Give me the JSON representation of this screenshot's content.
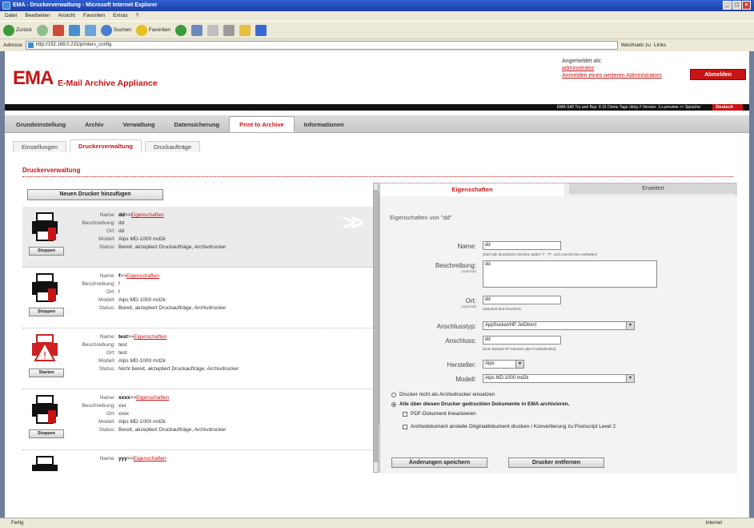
{
  "browser": {
    "title": "EMA - Druckerverwaltung - Microsoft Internet Explorer",
    "menu": [
      "Datei",
      "Bearbeiten",
      "Ansicht",
      "Favoriten",
      "Extras",
      "?"
    ],
    "toolbar": {
      "back": "Zurück",
      "search": "Suchen",
      "favorites": "Favoriten"
    },
    "address_label": "Adresse",
    "address": "http://192.168.0.231/printers_config",
    "go_label": "Wechseln zu",
    "links_label": "Links",
    "status_left": "Fertig",
    "status_zone": "Internet"
  },
  "header": {
    "logo": "EMA",
    "logo_sub": "E-Mail Archive Appliance",
    "login_label": "Angemeldet als:",
    "login_user": "administrator",
    "login_other": "Anmelden eines weiteren Administrators",
    "logout": "Abmelden",
    "info_bar": "EMA-S40 Try and Buy: 8 31 Demo Tage übrig // Version: 3.x.preview >> Sprache:",
    "language": "Deutsch"
  },
  "mainnav": [
    "Grundeinstellung",
    "Archiv",
    "Verwaltung",
    "Datensicherung",
    "Print to Archive",
    "Informationen"
  ],
  "mainnav_active": 4,
  "subnav": [
    "Einstellungen",
    "Druckerverwaltung",
    "Druckaufträge"
  ],
  "subnav_active": 1,
  "section_title": "Druckerverwaltung",
  "add_printer": "Neuen Drucker hinzufügen",
  "field_labels": {
    "name": "Name:",
    "description": "Beschreibung:",
    "location": "Ort:",
    "model": "Modell:",
    "status": "Status:",
    "props_link": "Eigenschaften"
  },
  "printers": [
    {
      "name": "dd",
      "description": "dd",
      "location": "dd",
      "model": "Alps MD-1000 md2k",
      "status": "Bereit, akzeptiert Druckaufträge, Archivdrucker",
      "button": "Stoppen",
      "selected": true,
      "error": false
    },
    {
      "name": "f",
      "description": "f",
      "location": "f",
      "model": "Alps MD-1000 md2k",
      "status": "Bereit, akzeptiert Druckaufträge, Archivdrucker",
      "button": "Stoppen",
      "selected": false,
      "error": false
    },
    {
      "name": "test",
      "description": "test",
      "location": "test",
      "model": "Alps MD-1000 md2k",
      "status": "Nicht bereit, akzeptiert Druckaufträge, Archivdrucker",
      "button": "Starten",
      "selected": false,
      "error": true
    },
    {
      "name": "xxxx",
      "description": "xxx",
      "location": "xxxx",
      "model": "Alps MD-1000 md2k",
      "status": "Bereit, akzeptiert Druckaufträge, Archivdrucker",
      "button": "Stoppen",
      "selected": false,
      "error": false
    },
    {
      "name": "yyy",
      "description": "",
      "location": "",
      "model": "",
      "status": "",
      "button": "",
      "selected": false,
      "error": false
    }
  ],
  "panel": {
    "tab_properties": "Eigenschaften",
    "tab_advanced": "Erweitert",
    "heading": "Eigenschaften von \"dd\"",
    "name_label": "Name:",
    "name_value": "dd",
    "name_hint": "(Darf alle druckbaren Zeichen außer \"/\", \"#\", und Leerzeichen enthalten)",
    "desc_label": "Beschreibung:",
    "desc_optional": "(optional)",
    "desc_value": "dd",
    "loc_label": "Ort:",
    "loc_optional": "(optional)",
    "loc_value": "dd",
    "loc_hint": "(Standort des Druckers)",
    "conntype_label": "Anschlusstyp:",
    "conntype_value": "AppSocket/HP JetDirect",
    "conn_label": "Anschluss:",
    "conn_value": "dd",
    "conn_hint": "(Zum Beispiel IP-Adresse oder Fortlaufendes)",
    "maker_label": "Hersteller:",
    "maker_value": "Alps",
    "model_label": "Modell:",
    "model_value": "Alps MD-1000 md2k",
    "radio_no_archive": "Drucker nicht als Archivdrucker einsetzen",
    "radio_archive": "Alle über diesen Drucker gedruckten Dokumente in EMA archivieren.",
    "chk_pdf": "PDF-Dokument linearisieren",
    "chk_archive": "Archivdokument anstelle Originaldokument drucken / Konvertierung zu Postscript Level 2",
    "save": "Änderungen speichern",
    "remove": "Drucker entfernen"
  }
}
